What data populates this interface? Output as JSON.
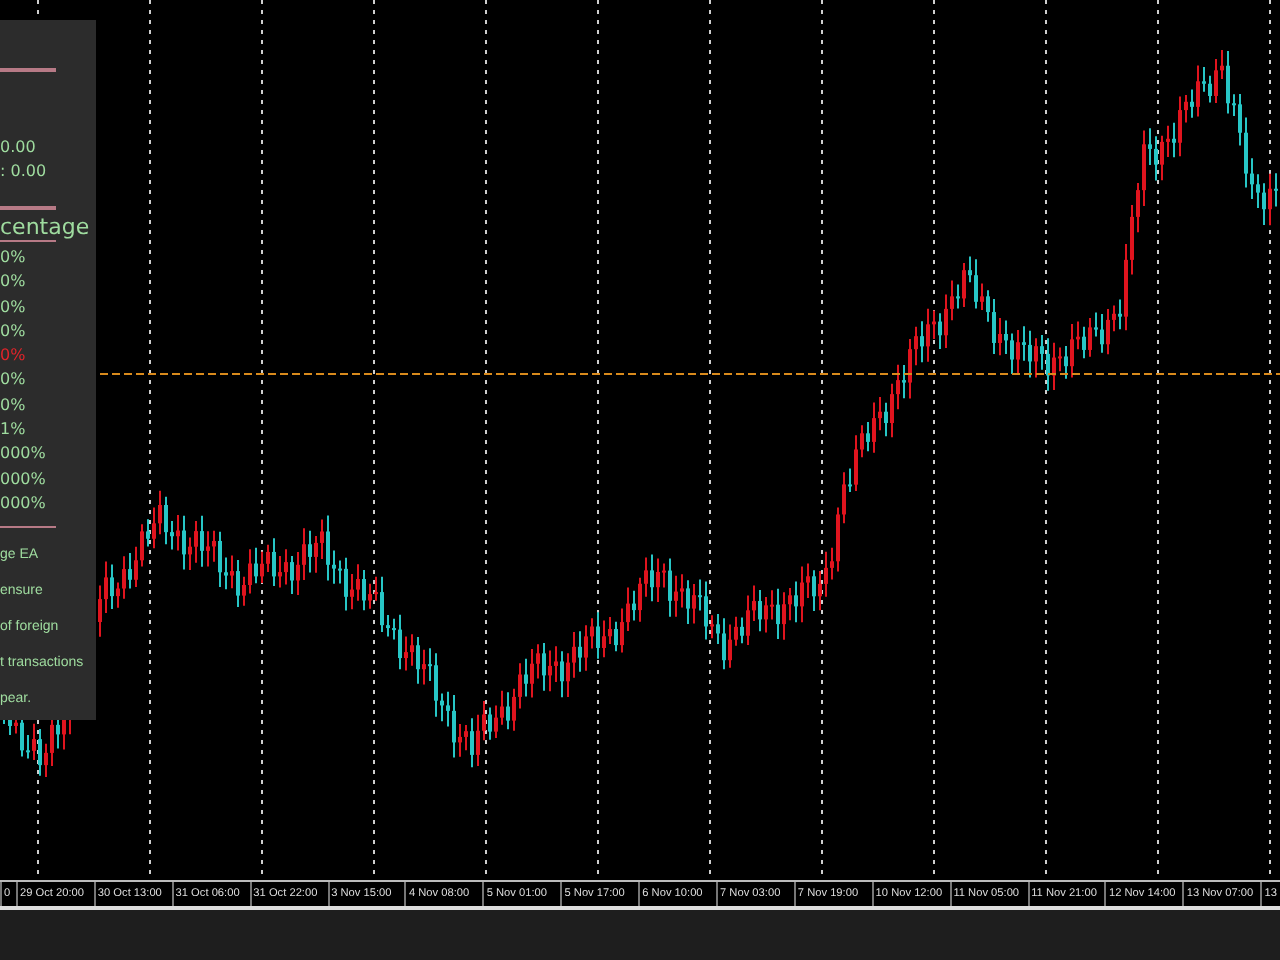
{
  "panel": {
    "values": [
      "0.00",
      ": 0.00"
    ],
    "heading": "centage",
    "percentages": [
      {
        "text": "0%",
        "negative": false
      },
      {
        "text": "0%",
        "negative": false
      },
      {
        "text": "0%",
        "negative": false
      },
      {
        "text": "0%",
        "negative": false
      },
      {
        "text": "0%",
        "negative": true
      },
      {
        "text": "0%",
        "negative": false
      },
      {
        "text": "0%",
        "negative": false
      },
      {
        "text": "1%",
        "negative": false
      },
      {
        "text": "000%",
        "negative": false
      },
      {
        "text": "000%",
        "negative": false
      },
      {
        "text": "000%",
        "negative": false
      }
    ],
    "notes": [
      "ge EA",
      "ensure",
      "of foreign",
      "t transactions",
      "pear."
    ]
  },
  "time_axis": {
    "labels": [
      "0",
      "29 Oct 20:00",
      "30 Oct 13:00",
      "31 Oct 06:00",
      "31 Oct 22:00",
      "3 Nov 15:00",
      "4 Nov 08:00",
      "5 Nov 01:00",
      "5 Nov 17:00",
      "6 Nov 10:00",
      "7 Nov 03:00",
      "7 Nov 19:00",
      "10 Nov 12:00",
      "11 Nov 05:00",
      "11 Nov 21:00",
      "12 Nov 14:00",
      "13 Nov 07:00",
      "13"
    ]
  }
}
